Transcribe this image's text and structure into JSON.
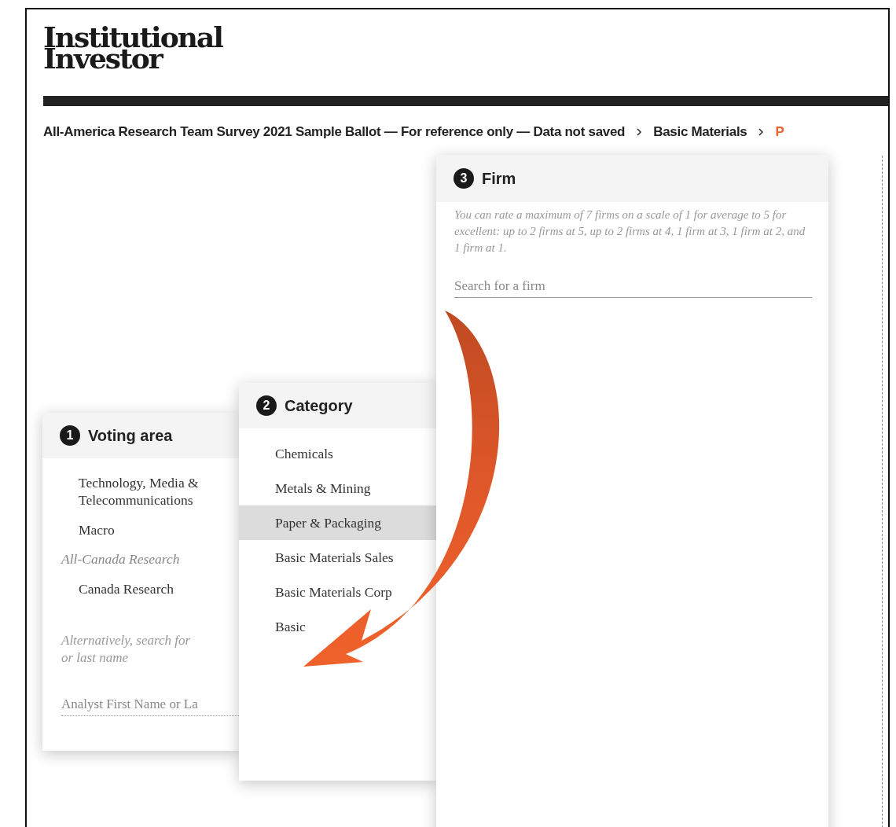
{
  "logo": "Institutional Investor",
  "breadcrumb": [
    {
      "label": "All-America Research Team Survey 2021 Sample Ballot — For reference only — Data not saved",
      "current": false
    },
    {
      "label": "Basic Materials",
      "current": false
    },
    {
      "label": "P",
      "current": true
    }
  ],
  "voting_area": {
    "number": "1",
    "title": "Voting area",
    "items": [
      {
        "kind": "item",
        "label": "Technology, Media & Telecommunications"
      },
      {
        "kind": "item",
        "label": "Macro"
      },
      {
        "kind": "group",
        "label": "All-Canada Research"
      },
      {
        "kind": "item",
        "label": "Canada Research"
      }
    ],
    "hint_lines": [
      "Alternatively, search for",
      "or last name"
    ],
    "search": {
      "placeholder": "Analyst First Name or La"
    }
  },
  "category": {
    "number": "2",
    "title": "Category",
    "items": [
      {
        "label": "Chemicals",
        "selected": false
      },
      {
        "label": "Metals & Mining",
        "selected": false
      },
      {
        "label": "Paper & Packaging",
        "selected": true
      },
      {
        "label": "Basic Materials Sales",
        "selected": false
      },
      {
        "label": "Basic Materials Corp",
        "selected": false
      },
      {
        "label": "Basic",
        "selected": false
      }
    ]
  },
  "firm": {
    "number": "3",
    "title": "Firm",
    "hint": "You can rate a maximum of 7 firms on a scale of 1 for average to 5 for excellent: up to 2 firms at 5, up to 2 firms at 4, 1 firm at 3, 1 firm at 2, and 1 firm at 1.",
    "search": {
      "placeholder": "Search for a firm"
    }
  }
}
